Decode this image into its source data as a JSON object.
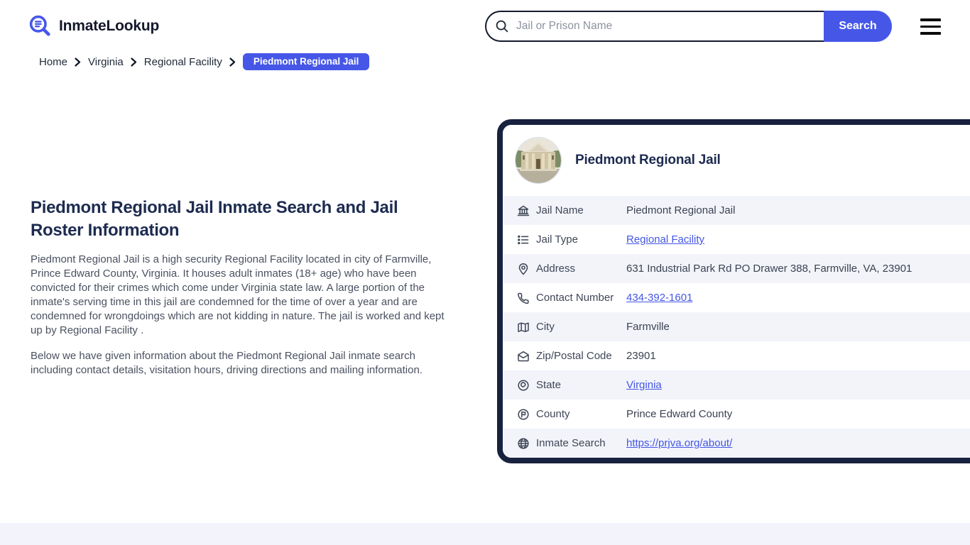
{
  "header": {
    "logo_text": "InmateLookup",
    "search": {
      "placeholder": "Jail or Prison Name",
      "button_label": "Search"
    }
  },
  "breadcrumb": {
    "items": [
      {
        "label": "Home"
      },
      {
        "label": "Virginia"
      },
      {
        "label": "Regional Facility"
      }
    ],
    "current": "Piedmont Regional Jail"
  },
  "article": {
    "heading": "Piedmont Regional Jail Inmate Search and Jail Roster Information",
    "paragraph1": "Piedmont Regional Jail is a high security Regional Facility located in city of Farmville, Prince Edward County, Virginia. It houses adult inmates (18+ age) who have been convicted for their crimes which come under Virginia state law. A large portion of the inmate's serving time in this jail are condemned for the time of over a year and are condemned for wrongdoings which are not kidding in nature. The jail is worked and kept up by Regional Facility .",
    "paragraph2": "Below we have given information about the Piedmont Regional Jail inmate search including contact details, visitation hours, driving directions and mailing information."
  },
  "card": {
    "title": "Piedmont Regional Jail",
    "rows": [
      {
        "icon": "bank-icon",
        "label": "Jail Name",
        "value": "Piedmont Regional Jail",
        "link": false
      },
      {
        "icon": "list-icon",
        "label": "Jail Type",
        "value": "Regional Facility",
        "link": true
      },
      {
        "icon": "pin-icon",
        "label": "Address",
        "value": "631 Industrial Park Rd PO Drawer 388, Farmville, VA, 23901",
        "link": false
      },
      {
        "icon": "phone-icon",
        "label": "Contact Number",
        "value": "434-392-1601",
        "link": true
      },
      {
        "icon": "map-icon",
        "label": "City",
        "value": "Farmville",
        "link": false
      },
      {
        "icon": "mail-open-icon",
        "label": "Zip/Postal Code",
        "value": "23901",
        "link": false
      },
      {
        "icon": "state-icon",
        "label": "State",
        "value": "Virginia",
        "link": true
      },
      {
        "icon": "county-icon",
        "label": "County",
        "value": "Prince Edward County",
        "link": false
      },
      {
        "icon": "globe-icon",
        "label": "Inmate Search",
        "value": "https://prjva.org/about/",
        "link": true
      }
    ]
  },
  "colors": {
    "primary": "#4657e8",
    "link": "#4356e4",
    "card_border_navy": "#18223f",
    "row_alt_background": "#f2f4fa",
    "footer_strip": "#f3f4fb"
  }
}
